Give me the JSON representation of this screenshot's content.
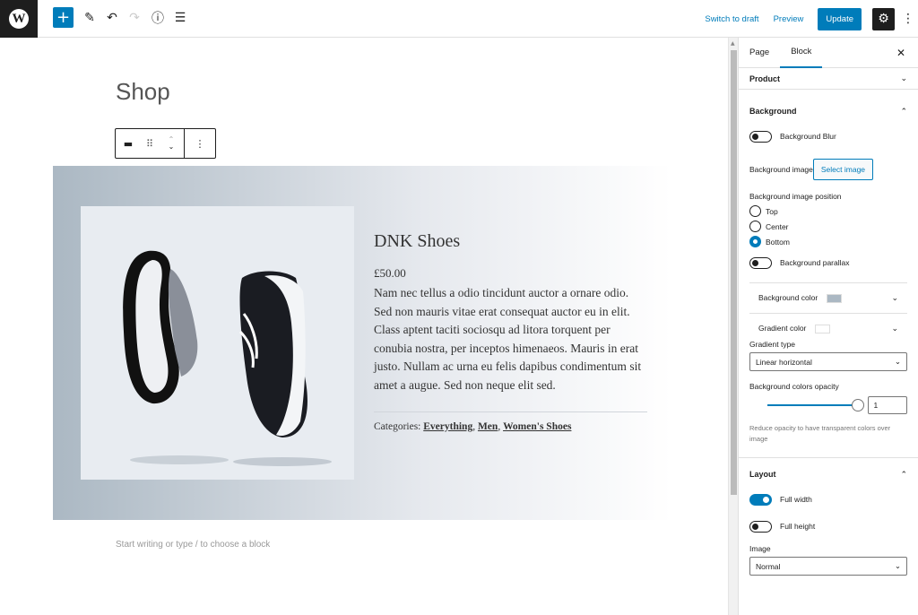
{
  "topbar": {
    "logo": "W",
    "add_icon": "+",
    "tools_icon": "✎",
    "undo_icon": "↶",
    "redo_icon": "↷",
    "info_icon": "ⓘ",
    "list_view_icon": "☰",
    "switch_to_draft": "Switch to draft",
    "preview": "Preview",
    "update": "Update",
    "settings_icon": "⚙",
    "more_icon": "⋮"
  },
  "editor": {
    "page_title": "Shop",
    "block_toolbar": {
      "block_icon": "▬",
      "drag_icon": "⠿",
      "move_icon": "⌃⌄",
      "more_icon": "⋮"
    },
    "product": {
      "name": "DNK Shoes",
      "price": "£50.00",
      "description": "Nam nec tellus a odio tincidunt auctor a ornare odio. Sed non mauris vitae erat consequat auctor eu in elit. Class aptent taciti sociosqu ad litora torquent per conubia nostra, per inceptos himenaeos. Mauris in erat justo. Nullam ac urna eu felis dapibus condimentum sit amet a augue. Sed non neque elit sed.",
      "categories_label": "Categories:",
      "categories": [
        "Everything",
        "Men",
        "Women's Shoes"
      ]
    },
    "placeholder": "Start writing or type / to choose a block"
  },
  "sidebar": {
    "tabs": [
      "Page",
      "Block"
    ],
    "active_tab": "Block",
    "close_icon": "✕",
    "product_panel": "Product",
    "background_panel": "Background",
    "background_blur": {
      "label": "Background Blur",
      "on": false
    },
    "background_image_label": "Background image",
    "select_image": "Select image",
    "position_label": "Background image position",
    "positions": [
      "Top",
      "Center",
      "Bottom"
    ],
    "selected_position": "Bottom",
    "background_parallax": {
      "label": "Background parallax",
      "on": false
    },
    "background_color": {
      "label": "Background color",
      "value": "#abb8c3"
    },
    "gradient_color": {
      "label": "Gradient color",
      "value": "#ffffff"
    },
    "gradient_type": {
      "label": "Gradient type",
      "value": "Linear horizontal"
    },
    "opacity": {
      "label": "Background colors opacity",
      "value": "1",
      "fraction": 1.0
    },
    "opacity_help": "Reduce opacity to have transparent colors over image",
    "layout_panel": "Layout",
    "full_width": {
      "label": "Full width",
      "on": true
    },
    "full_height": {
      "label": "Full height",
      "on": false
    },
    "image": {
      "label": "Image",
      "value": "Normal"
    },
    "chevron_down": "⌄",
    "chevron_up": "⌃"
  },
  "colors": {
    "accent": "#007cba",
    "dark": "#1e1e1e"
  }
}
